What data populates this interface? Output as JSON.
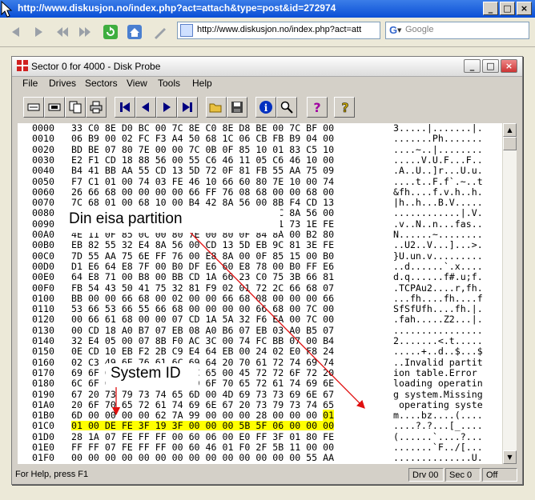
{
  "browser": {
    "title": "http://www.diskusjon.no/index.php?act=attach&type=post&id=272974",
    "url": "http://www.diskusjon.no/index.php?act=att",
    "search_placeholder": "Google",
    "window_buttons": [
      "_",
      "□",
      "×"
    ]
  },
  "app": {
    "title": "Sector 0 for 4000 - Disk Probe",
    "menu": [
      "File",
      "Drives",
      "Sectors",
      "View",
      "Tools",
      "Help"
    ],
    "toolbar_icons": [
      "read-sectors-icon",
      "write-sectors-icon",
      "copy-icon",
      "print-icon",
      "first-sector-icon",
      "previous-sector-icon",
      "next-sector-icon",
      "last-sector-icon",
      "open-folder-icon",
      "save-icon",
      "info-icon",
      "find-icon",
      "help-icon",
      "context-help-icon"
    ],
    "status": {
      "message": "For Help, press F1",
      "drive": "Drv 00",
      "sector": "Sec 0",
      "offset": "Off"
    }
  },
  "hex_rows": [
    {
      "off": "0000",
      "hex": "33 C0 8E D0 BC 00 7C 8E C0 8E D8 BE 00 7C BF 00",
      "asc": "3.....|.......|."
    },
    {
      "off": "0010",
      "hex": "06 B9 00 02 FC F3 A4 50 68 1C 06 CB FB B9 04 00",
      "asc": ".......Ph......."
    },
    {
      "off": "0020",
      "hex": "BD BE 07 80 7E 00 00 7C 0B 0F 85 10 01 83 C5 10",
      "asc": "....~..|........"
    },
    {
      "off": "0030",
      "hex": "E2 F1 CD 18 88 56 00 55 C6 46 11 05 C6 46 10 00",
      "asc": ".....V.U.F...F.."
    },
    {
      "off": "0040",
      "hex": "B4 41 BB AA 55 CD 13 5D 72 0F 81 FB 55 AA 75 09",
      "asc": ".A..U..]r...U.u."
    },
    {
      "off": "0050",
      "hex": "F7 C1 01 00 74 03 FE 46 10 66 60 80 7E 10 00 74",
      "asc": "....t..F.f`.~..t"
    },
    {
      "off": "0060",
      "hex": "26 66 68 00 00 00 00 66 FF 76 08 68 00 00 68 00",
      "asc": "&fh....f.v.h..h."
    },
    {
      "off": "0070",
      "hex": "7C 68 01 00 68 10 00 B4 42 8A 56 00 8B F4 CD 13",
      "asc": "|h..h...B.V....."
    },
    {
      "off": "0080",
      "hex": "9F 83 C4 10 9E EB 14 B8 01 02 BB 00 7C 8A 56 00",
      "asc": "............|.V."
    },
    {
      "off": "0090",
      "hex": "8A 76 01 8A 4E 02 8A 6E 03 CD 13 66 61 73 1E FE",
      "asc": ".v..N..n...fas.."
    },
    {
      "off": "00A0",
      "hex": "4E 11 0F 85 0C 00 80 7E 00 80 0F 84 8A 00 B2 80",
      "asc": "N......~........"
    },
    {
      "off": "00B0",
      "hex": "EB 82 55 32 E4 8A 56 00 CD 13 5D EB 9C 81 3E FE",
      "asc": "..U2..V...]...>."
    },
    {
      "off": "00C0",
      "hex": "7D 55 AA 75 6E FF 76 00 E8 8A 00 0F 85 15 00 B0",
      "asc": "}U.un.v........."
    },
    {
      "off": "00D0",
      "hex": "D1 E6 64 E8 7F 00 B0 DF E6 60 E8 78 00 B0 FF E6",
      "asc": "..d......`.x...."
    },
    {
      "off": "00E0",
      "hex": "64 E8 71 00 B8 00 BB CD 1A 66 23 C0 75 3B 66 81",
      "asc": "d.q......f#.u;f."
    },
    {
      "off": "00F0",
      "hex": "FB 54 43 50 41 75 32 81 F9 02 01 72 2C 66 68 07",
      "asc": ".TCPAu2....r,fh."
    },
    {
      "off": "0100",
      "hex": "BB 00 00 66 68 00 02 00 00 66 68 08 00 00 00 66",
      "asc": "...fh....fh....f"
    },
    {
      "off": "0110",
      "hex": "53 66 53 66 55 66 68 00 00 00 00 66 68 00 7C 00",
      "asc": "SfSfUfh....fh.|."
    },
    {
      "off": "0120",
      "hex": "00 66 61 68 00 00 07 CD 1A 5A 32 F6 EA 00 7C 00",
      "asc": ".fah.....Z2...|."
    },
    {
      "off": "0130",
      "hex": "00 CD 18 A0 B7 07 EB 08 A0 B6 07 EB 03 A0 B5 07",
      "asc": "................"
    },
    {
      "off": "0140",
      "hex": "32 E4 05 00 07 8B F0 AC 3C 00 74 FC BB 07 00 B4",
      "asc": "2.......<.t....."
    },
    {
      "off": "0150",
      "hex": "0E CD 10 EB F2 2B C9 E4 64 EB 00 24 02 E0 F8 24",
      "asc": ".....+..d..$...$"
    },
    {
      "off": "0160",
      "hex": "02 C3 49 6E 76 61 6C 69 64 20 70 61 72 74 69 74",
      "asc": "..Invalid partit"
    },
    {
      "off": "0170",
      "hex": "69 6F 6E 20 74 61 62 6C 65 00 45 72 72 6F 72 20",
      "asc": "ion table.Error "
    },
    {
      "off": "0180",
      "hex": "6C 6F 61 64 69 6E 67 20 6F 70 65 72 61 74 69 6E",
      "asc": "loading operatin"
    },
    {
      "off": "0190",
      "hex": "67 20 73 79 73 74 65 6D 00 4D 69 73 73 69 6E 67",
      "asc": "g system.Missing"
    },
    {
      "off": "01A0",
      "hex": "20 6F 70 65 72 61 74 69 6E 67 20 73 79 73 74 65",
      "asc": " operating syste"
    },
    {
      "off": "01B0",
      "hex": "6D 00 00 00 00 62 7A 99 00 00 00 28 00 00 00 01",
      "asc": "m....bz....(...."
    },
    {
      "off": "01C0",
      "hex": "01 00 DE FE 3F 19 3F 00 00 00 5B 5F 06 00 00 00",
      "asc": "....?.?...[_...."
    },
    {
      "off": "01D0",
      "hex": "28 1A 07 FE FF FF 00 60 06 00 E0 FF 3F 01 80 FE",
      "asc": "(......`....?..."
    },
    {
      "off": "01E0",
      "hex": "FF FF 07 FE FF FF 00 60 46 01 F0 2F 5B 11 00 00",
      "asc": ".......`F../[..."
    },
    {
      "off": "01F0",
      "hex": "00 00 00 00 00 00 00 00 00 00 00 00 00 00 55 AA",
      "asc": "..............U."
    }
  ],
  "annotations": {
    "partition_label": "Din eisa partition",
    "system_id_label": "System ID",
    "arrow_color": "#e01010",
    "highlight_color": "#ffff00"
  }
}
